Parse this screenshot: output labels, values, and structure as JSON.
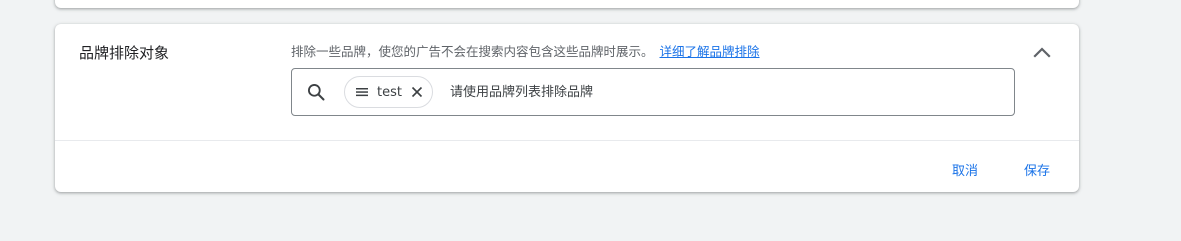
{
  "section": {
    "title": "品牌排除对象",
    "description": "排除一些品牌，使您的广告不会在搜索内容包含这些品牌时展示。",
    "learn_more_link": "详细了解品牌排除",
    "collapse_icon": "chevron-up-icon"
  },
  "search": {
    "icon": "search-icon",
    "placeholder": "请使用品牌列表排除品牌",
    "value": "",
    "chips": [
      {
        "label": "test",
        "icon": "list-icon",
        "remove_icon": "close-icon"
      }
    ]
  },
  "actions": {
    "cancel_label": "取消",
    "save_label": "保存"
  },
  "colors": {
    "accent": "#1a73e8",
    "background": "#f1f3f4",
    "card": "#ffffff",
    "border": "#80868b"
  }
}
